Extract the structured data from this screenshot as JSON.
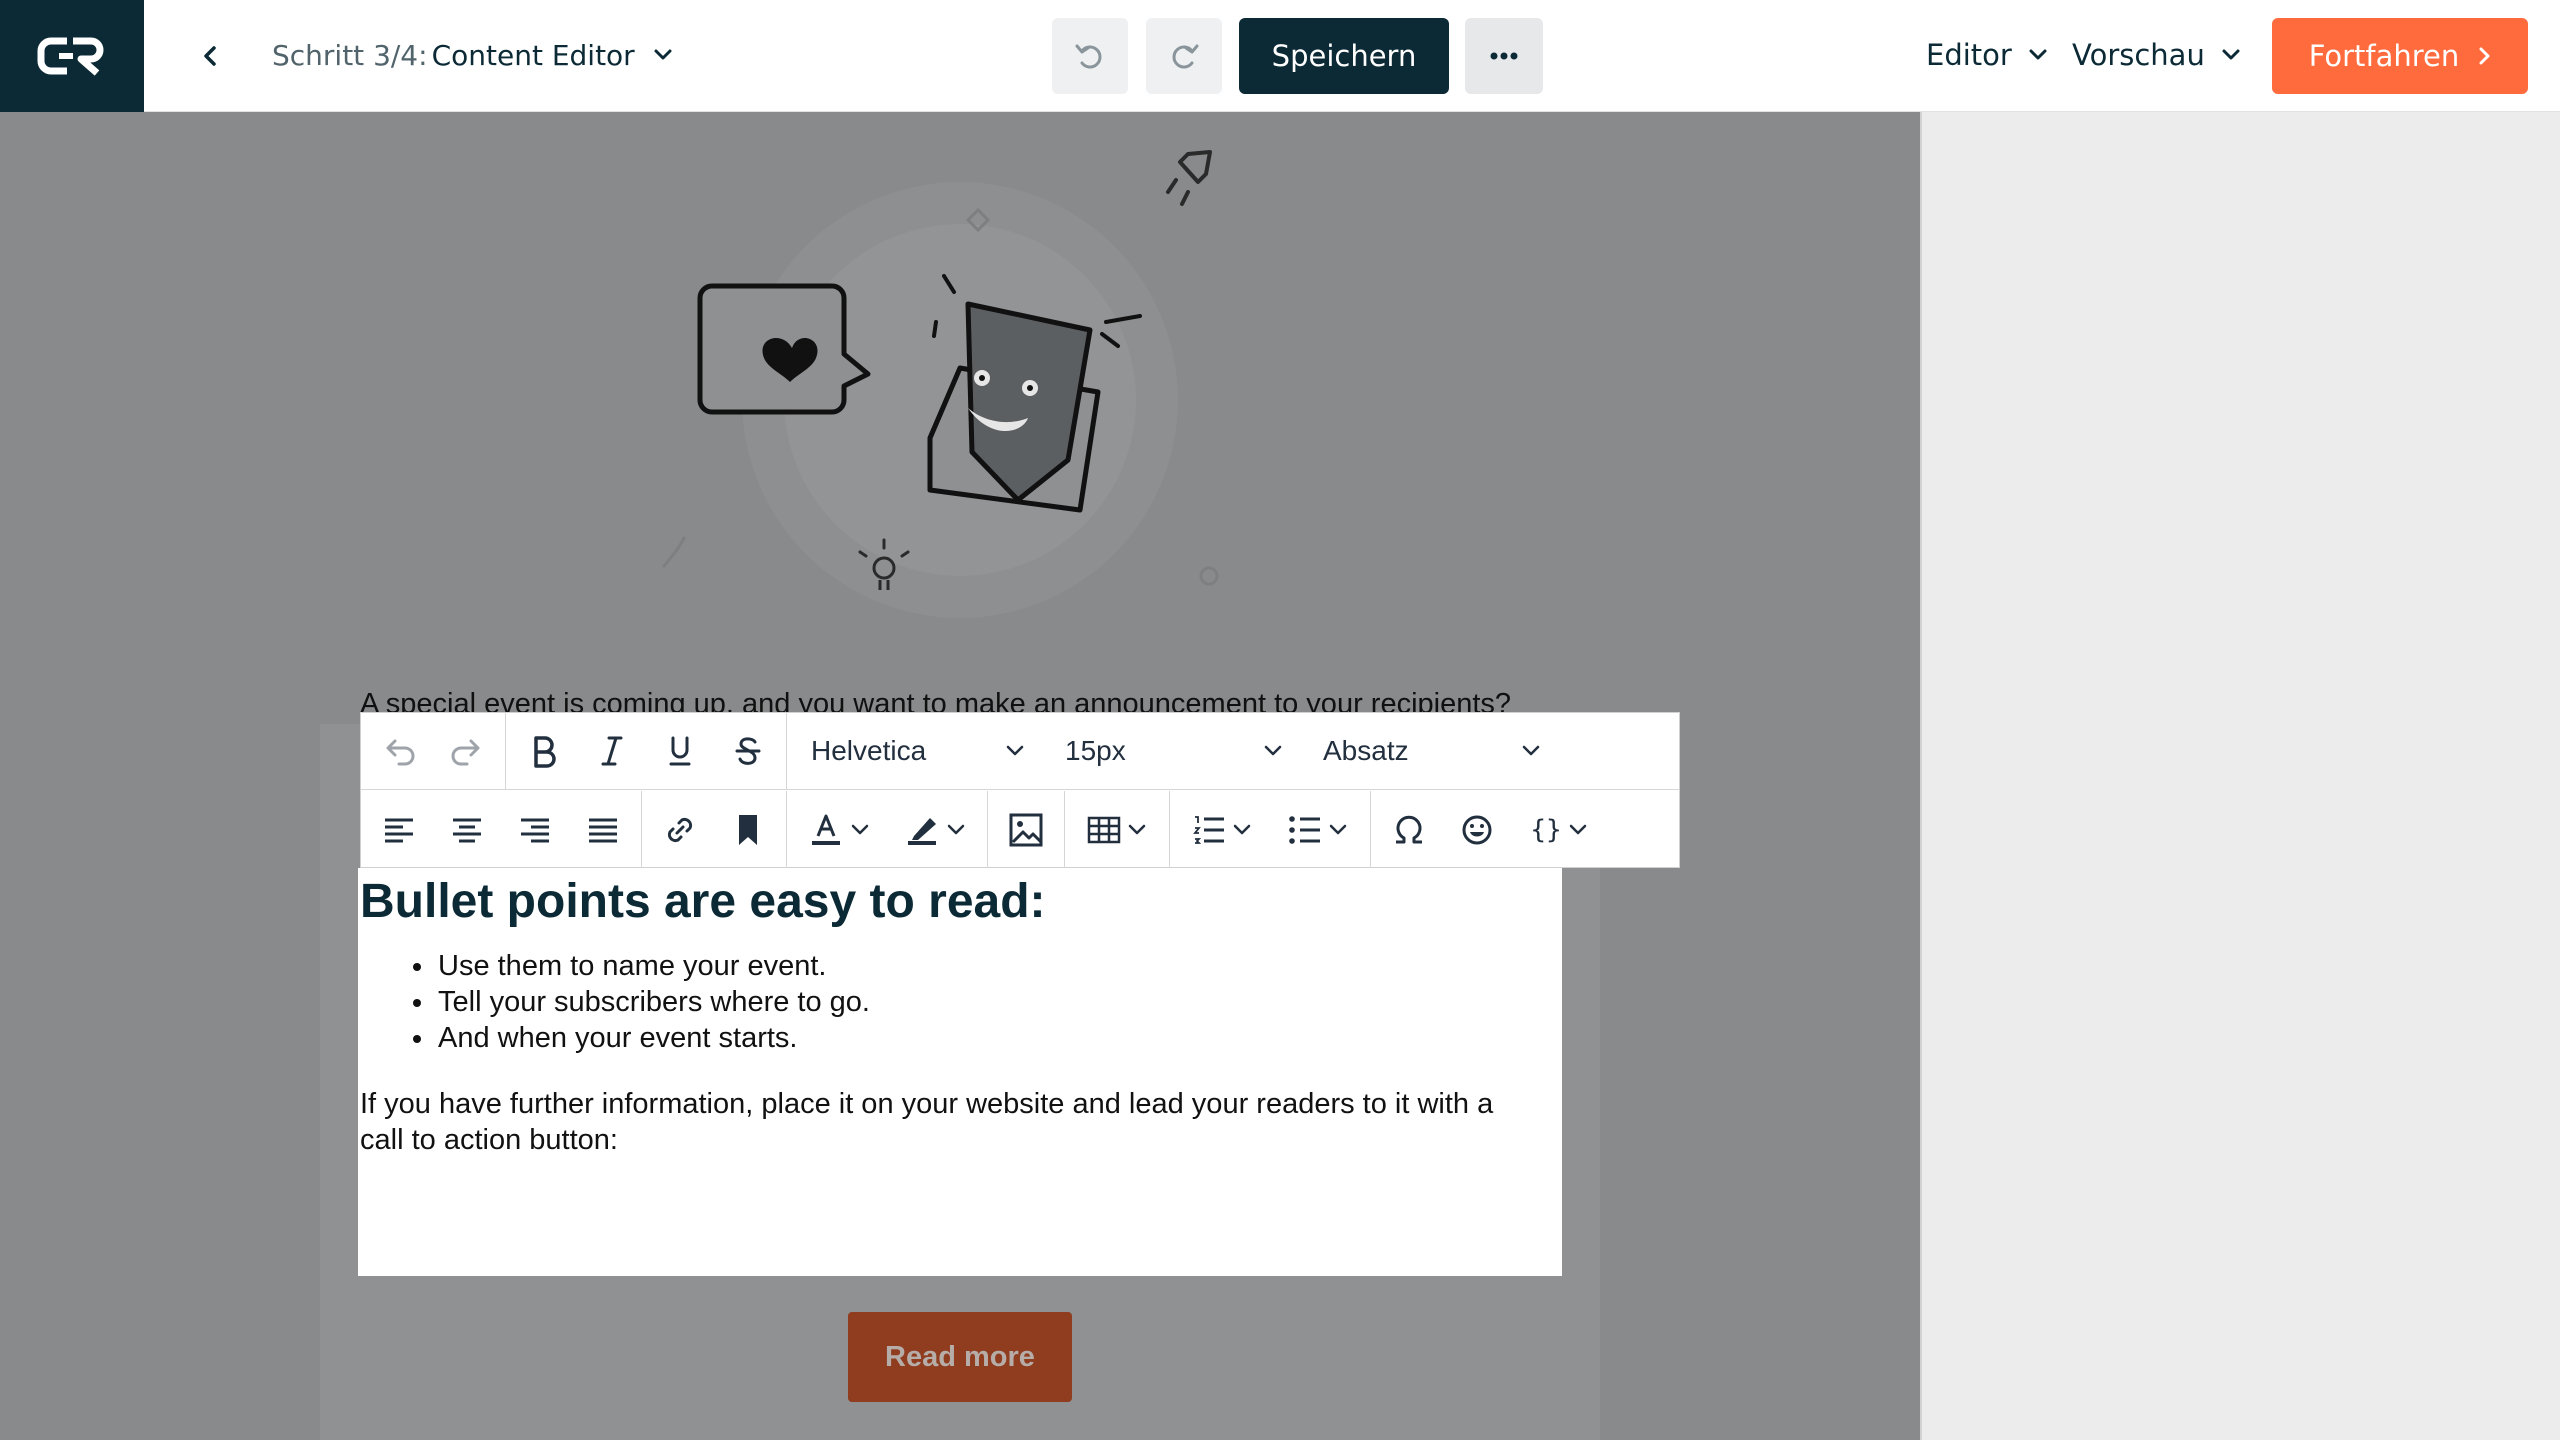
{
  "header": {
    "logo_text": "CR",
    "step_prefix": "Schritt 3/4:",
    "step_title": "Content Editor",
    "save_label": "Speichern",
    "view_editor_label": "Editor",
    "view_preview_label": "Vorschau",
    "continue_label": "Fortfahren"
  },
  "email": {
    "intro": "A special event is coming up, and you want to make an announcement to your recipients?",
    "heading": "Bullet points are easy to read:",
    "bullets": [
      "Use them to name your event.",
      "Tell your subscribers where to go.",
      "And when your event starts."
    ],
    "info": "If you have further information, place it on your website and lead your readers to it with a call to action button:",
    "cta_label": "Read more"
  },
  "toolbar": {
    "font_family": "Helvetica",
    "font_size": "15px",
    "block_format": "Absatz",
    "source_code_label": "{}"
  },
  "colors": {
    "brand_dark": "#0b2a35",
    "accent_orange": "#ff6b3d",
    "cta_background": "#8f3c1f",
    "canvas_overlay": "#888a8b"
  }
}
